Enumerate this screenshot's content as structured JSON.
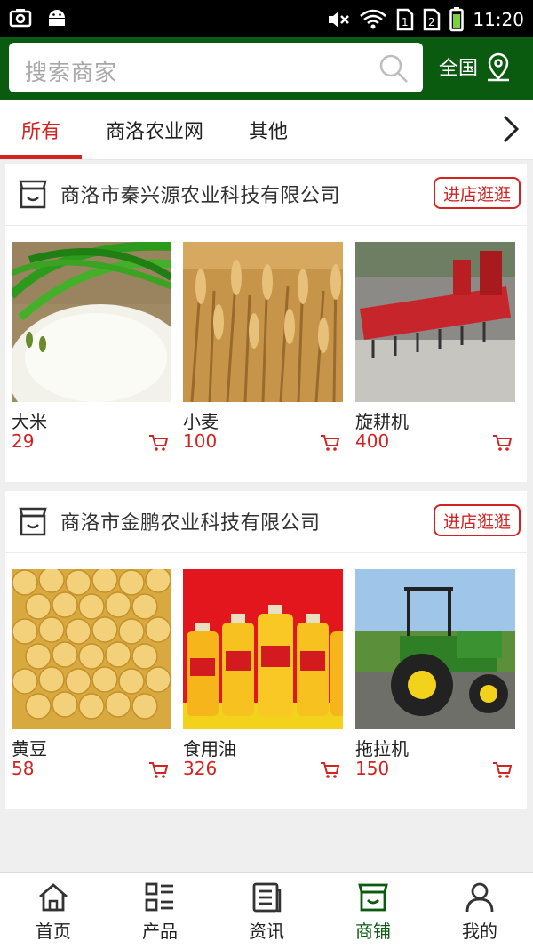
{
  "status_bar": {
    "time": "11:20",
    "icons": [
      "screenshot-icon",
      "android-icon",
      "mute-icon",
      "wifi-icon",
      "sim1-icon",
      "sim2-icon",
      "battery-icon"
    ]
  },
  "search": {
    "placeholder": "搜索商家"
  },
  "region": {
    "label": "全国"
  },
  "tabs": [
    {
      "label": "所有",
      "active": true
    },
    {
      "label": "商洛农业网",
      "active": false
    },
    {
      "label": "其他",
      "active": false
    }
  ],
  "stores": [
    {
      "name": "商洛市秦兴源农业科技有限公司",
      "visit_label": "进店逛逛",
      "products": [
        {
          "name": "大米",
          "price": "29"
        },
        {
          "name": "小麦",
          "price": "100"
        },
        {
          "name": "旋耕机",
          "price": "400"
        }
      ]
    },
    {
      "name": "商洛市金鹏农业科技有限公司",
      "visit_label": "进店逛逛",
      "products": [
        {
          "name": "黄豆",
          "price": "58"
        },
        {
          "name": "食用油",
          "price": "326"
        },
        {
          "name": "拖拉机",
          "price": "150"
        }
      ]
    }
  ],
  "bottom_nav": [
    {
      "label": "首页",
      "icon": "home-icon",
      "active": false
    },
    {
      "label": "产品",
      "icon": "product-list-icon",
      "active": false
    },
    {
      "label": "资讯",
      "icon": "news-icon",
      "active": false
    },
    {
      "label": "商铺",
      "icon": "store-icon",
      "active": true
    },
    {
      "label": "我的",
      "icon": "user-icon",
      "active": false
    }
  ],
  "colors": {
    "brand_green": "#0a5a10",
    "accent_red": "#d32222",
    "background": "#efefef"
  }
}
